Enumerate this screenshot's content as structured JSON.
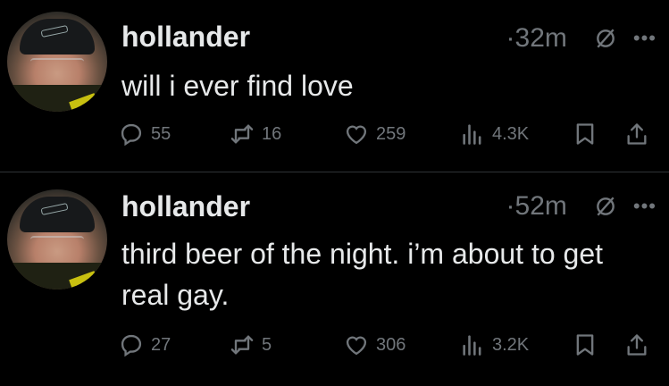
{
  "tweets": [
    {
      "author": "hollander",
      "time": "·32m",
      "text": "will i ever find love",
      "stats": {
        "replies": "55",
        "retweets": "16",
        "likes": "259",
        "views": "4.3K"
      }
    },
    {
      "author": "hollander",
      "time": "·52m",
      "text": "third beer of the night. i’m about to get real gay.",
      "stats": {
        "replies": "27",
        "retweets": "5",
        "likes": "306",
        "views": "3.2K"
      }
    }
  ],
  "icons": {
    "reply": "reply-icon",
    "retweet": "retweet-icon",
    "like": "heart-icon",
    "views": "views-icon",
    "bookmark": "bookmark-icon",
    "share": "share-icon",
    "grok": "grok-icon",
    "more": "more-icon"
  },
  "colors": {
    "background": "#000000",
    "text": "#e7e9ea",
    "muted": "#71767b",
    "divider": "#2f3336"
  }
}
